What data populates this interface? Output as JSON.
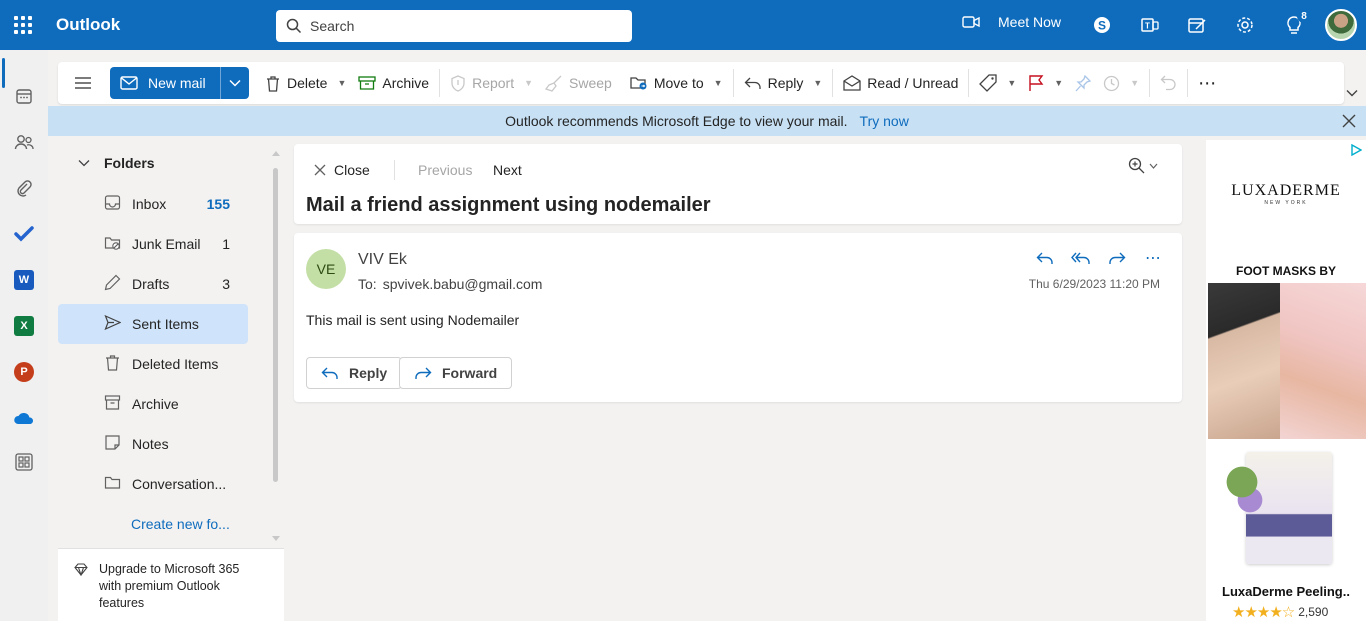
{
  "app": {
    "title": "Outlook"
  },
  "search": {
    "placeholder": "Search"
  },
  "topbar": {
    "meet_now_label": "Meet Now",
    "notification_count": "8"
  },
  "ribbon": {
    "new_mail": "New mail",
    "delete": "Delete",
    "archive": "Archive",
    "report": "Report",
    "sweep": "Sweep",
    "move_to": "Move to",
    "reply": "Reply",
    "read_unread": "Read / Unread"
  },
  "banner": {
    "text": "Outlook recommends Microsoft Edge to view your mail.",
    "link": "Try now"
  },
  "folders": {
    "heading": "Folders",
    "items": [
      {
        "label": "Inbox",
        "count": "155",
        "icon": "inbox-icon"
      },
      {
        "label": "Junk Email",
        "count": "1",
        "icon": "junk-icon"
      },
      {
        "label": "Drafts",
        "count": "3",
        "icon": "drafts-icon"
      },
      {
        "label": "Sent Items",
        "count": "",
        "icon": "sent-icon"
      },
      {
        "label": "Deleted Items",
        "count": "",
        "icon": "trash-icon"
      },
      {
        "label": "Archive",
        "count": "",
        "icon": "archive-icon"
      },
      {
        "label": "Notes",
        "count": "",
        "icon": "notes-icon"
      },
      {
        "label": "Conversation...",
        "count": "",
        "icon": "folder-icon"
      }
    ],
    "create_new": "Create new fo..."
  },
  "upgrade": {
    "text": "Upgrade to Microsoft 365 with premium Outlook features"
  },
  "reading_pane": {
    "close": "Close",
    "previous": "Previous",
    "next": "Next",
    "subject": "Mail a friend assignment using nodemailer"
  },
  "message": {
    "avatar_initials": "VE",
    "sender": "VIV Ek",
    "to_label": "To:",
    "to_address": "spvivek.babu@gmail.com",
    "date": "Thu 6/29/2023 11:20 PM",
    "body": "This mail is sent using Nodemailer",
    "reply_button": "Reply",
    "forward_button": "Forward"
  },
  "ad": {
    "brand": "LUXADERME",
    "brand_sub": "NEW YORK",
    "headline": "FOOT MASKS BY",
    "product_title": "LuxaDerme Peeling..",
    "stars": "★★★★☆",
    "rating_count": "2,590"
  },
  "colors": {
    "brand_blue": "#0f6cbd",
    "banner_bg": "#c7e0f4",
    "selected_folder": "#cfe4fa"
  }
}
